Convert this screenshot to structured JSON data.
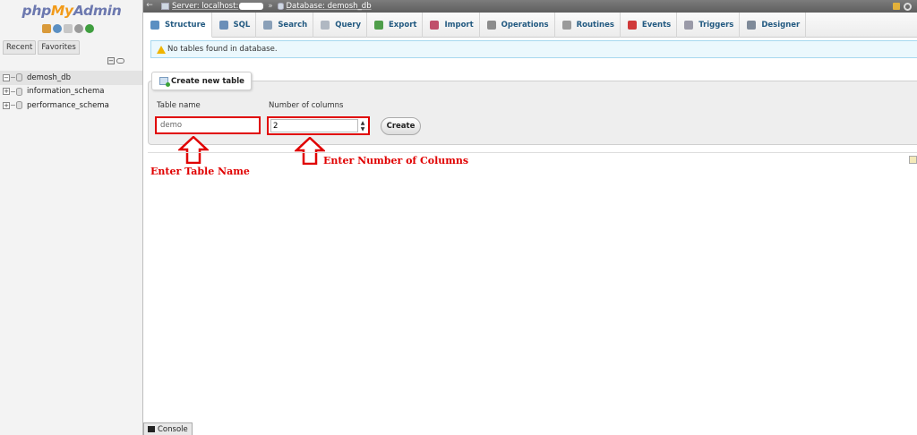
{
  "nav": {
    "logo": {
      "php": "php",
      "my": "My",
      "admin": "Admin"
    },
    "icons": [
      "home-icon",
      "exit-icon",
      "docs-icon",
      "settings-icon",
      "reload-icon"
    ],
    "tabs": [
      {
        "label": "Recent"
      },
      {
        "label": "Favorites"
      }
    ],
    "databases": [
      {
        "name": "demosh_db",
        "expander": "−",
        "active": true
      },
      {
        "name": "information_schema",
        "expander": "+",
        "active": false
      },
      {
        "name": "performance_schema",
        "expander": "+",
        "active": false
      }
    ]
  },
  "breadcrumb": {
    "server_label": "Server: localhost:",
    "separator": "»",
    "database_label": "Database: demosh_db"
  },
  "tabs": [
    {
      "label": "Structure",
      "icon": "structure-icon",
      "color": "#5b8fc2",
      "active": true
    },
    {
      "label": "SQL",
      "icon": "sql-icon",
      "color": "#6b8fb8",
      "active": false
    },
    {
      "label": "Search",
      "icon": "search-icon",
      "color": "#8aa0b8",
      "active": false
    },
    {
      "label": "Query",
      "icon": "query-icon",
      "color": "#b0b8c2",
      "active": false
    },
    {
      "label": "Export",
      "icon": "export-icon",
      "color": "#4f9e4a",
      "active": false
    },
    {
      "label": "Import",
      "icon": "import-icon",
      "color": "#c0506b",
      "active": false
    },
    {
      "label": "Operations",
      "icon": "operations-icon",
      "color": "#8c8c8c",
      "active": false
    },
    {
      "label": "Routines",
      "icon": "routines-icon",
      "color": "#9a9a9a",
      "active": false
    },
    {
      "label": "Events",
      "icon": "events-icon",
      "color": "#d03a3a",
      "active": false
    },
    {
      "label": "Triggers",
      "icon": "triggers-icon",
      "color": "#9a9aa8",
      "active": false
    },
    {
      "label": "Designer",
      "icon": "designer-icon",
      "color": "#7f8a99",
      "active": false
    }
  ],
  "notice": {
    "text": "No tables found in database."
  },
  "create_table": {
    "legend": "Create new table",
    "table_name_label": "Table name",
    "table_name_value": "demo",
    "num_columns_label": "Number of columns",
    "num_columns_value": "2",
    "create_label": "Create"
  },
  "annotations": {
    "table_name": "Enter Table Name",
    "num_columns": "Enter Number of Columns",
    "color": "#e00000"
  },
  "console": {
    "label": "Console"
  }
}
